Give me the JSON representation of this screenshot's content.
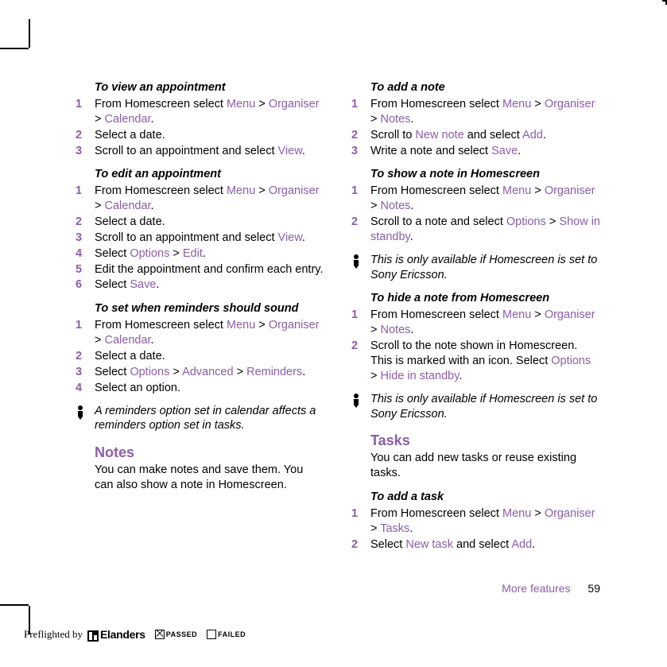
{
  "left": {
    "s1": {
      "title": "To view an appointment",
      "steps": [
        {
          "n": "1",
          "parts": [
            {
              "t": "From Homescreen select "
            },
            {
              "t": "Menu",
              "ui": true
            },
            {
              "t": " > "
            },
            {
              "t": "Organiser",
              "ui": true
            },
            {
              "t": " > "
            },
            {
              "t": "Calendar",
              "ui": true
            },
            {
              "t": "."
            }
          ]
        },
        {
          "n": "2",
          "parts": [
            {
              "t": "Select a date."
            }
          ]
        },
        {
          "n": "3",
          "parts": [
            {
              "t": "Scroll to an appointment and select "
            },
            {
              "t": "View",
              "ui": true
            },
            {
              "t": "."
            }
          ]
        }
      ]
    },
    "s2": {
      "title": "To edit an appointment",
      "steps": [
        {
          "n": "1",
          "parts": [
            {
              "t": "From Homescreen select "
            },
            {
              "t": "Menu",
              "ui": true
            },
            {
              "t": " > "
            },
            {
              "t": "Organiser",
              "ui": true
            },
            {
              "t": " > "
            },
            {
              "t": "Calendar",
              "ui": true
            },
            {
              "t": "."
            }
          ]
        },
        {
          "n": "2",
          "parts": [
            {
              "t": "Select a date."
            }
          ]
        },
        {
          "n": "3",
          "parts": [
            {
              "t": "Scroll to an appointment and select "
            },
            {
              "t": "View",
              "ui": true
            },
            {
              "t": "."
            }
          ]
        },
        {
          "n": "4",
          "parts": [
            {
              "t": "Select "
            },
            {
              "t": "Options",
              "ui": true
            },
            {
              "t": " > "
            },
            {
              "t": "Edit",
              "ui": true
            },
            {
              "t": "."
            }
          ]
        },
        {
          "n": "5",
          "parts": [
            {
              "t": "Edit the appointment and confirm each entry."
            }
          ]
        },
        {
          "n": "6",
          "parts": [
            {
              "t": "Select "
            },
            {
              "t": "Save",
              "ui": true
            },
            {
              "t": "."
            }
          ]
        }
      ]
    },
    "s3": {
      "title": "To set when reminders should sound",
      "steps": [
        {
          "n": "1",
          "parts": [
            {
              "t": "From Homescreen select "
            },
            {
              "t": "Menu",
              "ui": true
            },
            {
              "t": " > "
            },
            {
              "t": "Organiser",
              "ui": true
            },
            {
              "t": " > "
            },
            {
              "t": "Calendar",
              "ui": true
            },
            {
              "t": "."
            }
          ]
        },
        {
          "n": "2",
          "parts": [
            {
              "t": "Select a date."
            }
          ]
        },
        {
          "n": "3",
          "parts": [
            {
              "t": "Select "
            },
            {
              "t": "Options",
              "ui": true
            },
            {
              "t": " > "
            },
            {
              "t": "Advanced",
              "ui": true
            },
            {
              "t": " > "
            },
            {
              "t": "Reminders",
              "ui": true
            },
            {
              "t": "."
            }
          ]
        },
        {
          "n": "4",
          "parts": [
            {
              "t": "Select an option."
            }
          ]
        }
      ]
    },
    "note1": "A reminders option set in calendar affects a reminders option set in tasks.",
    "h1": "Notes",
    "intro1": "You can make notes and save them. You can also show a note in Homescreen."
  },
  "right": {
    "s1": {
      "title": "To add a note",
      "steps": [
        {
          "n": "1",
          "parts": [
            {
              "t": "From Homescreen select "
            },
            {
              "t": "Menu",
              "ui": true
            },
            {
              "t": " > "
            },
            {
              "t": "Organiser",
              "ui": true
            },
            {
              "t": " > "
            },
            {
              "t": "Notes",
              "ui": true
            },
            {
              "t": "."
            }
          ]
        },
        {
          "n": "2",
          "parts": [
            {
              "t": "Scroll to "
            },
            {
              "t": "New note",
              "ui": true
            },
            {
              "t": " and select "
            },
            {
              "t": "Add",
              "ui": true
            },
            {
              "t": "."
            }
          ]
        },
        {
          "n": "3",
          "parts": [
            {
              "t": "Write a note and select "
            },
            {
              "t": "Save",
              "ui": true
            },
            {
              "t": "."
            }
          ]
        }
      ]
    },
    "s2": {
      "title": "To show a note in Homescreen",
      "steps": [
        {
          "n": "1",
          "parts": [
            {
              "t": "From Homescreen select "
            },
            {
              "t": "Menu",
              "ui": true
            },
            {
              "t": " > "
            },
            {
              "t": "Organiser",
              "ui": true
            },
            {
              "t": " > "
            },
            {
              "t": "Notes",
              "ui": true
            },
            {
              "t": "."
            }
          ]
        },
        {
          "n": "2",
          "parts": [
            {
              "t": "Scroll to a note and select "
            },
            {
              "t": "Options",
              "ui": true
            },
            {
              "t": " > "
            },
            {
              "t": "Show in standby",
              "ui": true
            },
            {
              "t": "."
            }
          ]
        }
      ]
    },
    "note1": "This is only available if Homescreen is set to Sony Ericsson.",
    "s3": {
      "title": "To hide a note from Homescreen",
      "steps": [
        {
          "n": "1",
          "parts": [
            {
              "t": "From Homescreen select "
            },
            {
              "t": "Menu",
              "ui": true
            },
            {
              "t": " > "
            },
            {
              "t": "Organiser",
              "ui": true
            },
            {
              "t": " > "
            },
            {
              "t": "Notes",
              "ui": true
            },
            {
              "t": "."
            }
          ]
        },
        {
          "n": "2",
          "parts": [
            {
              "t": "Scroll to the note shown in Homescreen. This is marked with an icon. Select "
            },
            {
              "t": "Options",
              "ui": true
            },
            {
              "t": " > "
            },
            {
              "t": "Hide in standby",
              "ui": true
            },
            {
              "t": "."
            }
          ]
        }
      ]
    },
    "note2": "This is only available if Homescreen is set to Sony Ericsson.",
    "h1": "Tasks",
    "intro1": "You can add new tasks or reuse existing tasks.",
    "s4": {
      "title": "To add a task",
      "steps": [
        {
          "n": "1",
          "parts": [
            {
              "t": "From Homescreen select "
            },
            {
              "t": "Menu",
              "ui": true
            },
            {
              "t": " > "
            },
            {
              "t": "Organiser",
              "ui": true
            },
            {
              "t": " > "
            },
            {
              "t": "Tasks",
              "ui": true
            },
            {
              "t": "."
            }
          ]
        },
        {
          "n": "2",
          "parts": [
            {
              "t": "Select "
            },
            {
              "t": "New task",
              "ui": true
            },
            {
              "t": " and select "
            },
            {
              "t": "Add",
              "ui": true
            },
            {
              "t": "."
            }
          ]
        }
      ]
    }
  },
  "footer": {
    "section": "More features",
    "page": "59"
  },
  "preflight": {
    "label": "Preflighted by",
    "brand": "Elanders",
    "passed": "PASSED",
    "failed": "FAILED"
  }
}
